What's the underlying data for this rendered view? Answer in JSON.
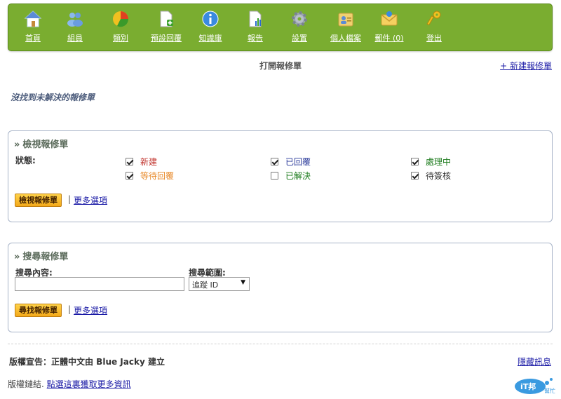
{
  "nav": {
    "items": [
      {
        "label": "首頁",
        "icon": "home-icon"
      },
      {
        "label": "組員",
        "icon": "users-icon"
      },
      {
        "label": "類別",
        "icon": "pie-chart-icon"
      },
      {
        "label": "預設回覆",
        "icon": "document-add-icon"
      },
      {
        "label": "知識庫",
        "icon": "info-icon"
      },
      {
        "label": "報告",
        "icon": "report-icon"
      },
      {
        "label": "設置",
        "icon": "gear-icon"
      },
      {
        "label": "個人檔案",
        "icon": "profile-icon"
      },
      {
        "label": "郵件 (0)",
        "icon": "mail-icon"
      },
      {
        "label": "登出",
        "icon": "key-icon"
      }
    ]
  },
  "page_title": "打開報修單",
  "new_ticket_link": "+ 新建報修單",
  "no_tickets_msg": "沒找到未解決的報修單",
  "view_panel": {
    "title": "檢視報修單",
    "status_label": "狀態:",
    "statuses": [
      {
        "label": "新建",
        "checked": true,
        "color": "#c0302a"
      },
      {
        "label": "已回覆",
        "checked": true,
        "color": "#2a3a9a"
      },
      {
        "label": "處理中",
        "checked": true,
        "color": "#1a7a1a"
      },
      {
        "label": "等待回覆",
        "checked": true,
        "color": "#e88a2a"
      },
      {
        "label": "已解決",
        "checked": false,
        "color": "#1a7a1a"
      },
      {
        "label": "待簽核",
        "checked": true,
        "color": "#333333"
      }
    ],
    "button": "檢視報修單",
    "separator": "|",
    "more_options": "更多選項"
  },
  "search_panel": {
    "title": "搜尋報修單",
    "content_label": "搜尋內容:",
    "content_value": "",
    "scope_label": "搜尋範圍:",
    "scope_value": "追蹤 ID",
    "button": "尋找報修單",
    "separator": "|",
    "more_options": "更多選項"
  },
  "footer": {
    "copyright": "版權宣告：正體中文由 Blue Jacky 建立",
    "hide_info": "隱藏訊息",
    "link_prefix": "版權鏈結.",
    "link_text": "點選這裏獲取更多資訊",
    "logo_text": "iT邦幫忙"
  }
}
